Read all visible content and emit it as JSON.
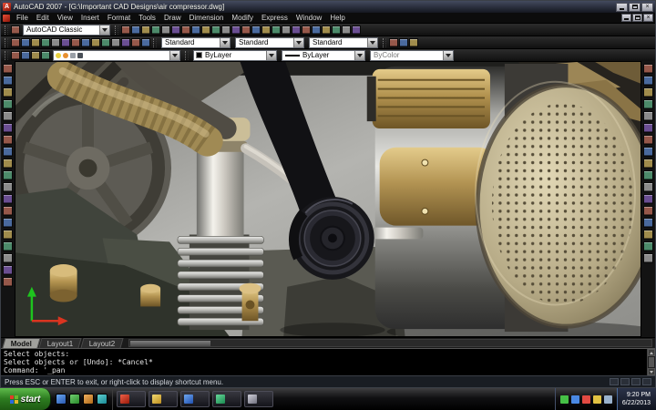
{
  "titlebar": {
    "title": "AutoCAD 2007 - [G:\\Important CAD Designs\\air compressor.dwg]"
  },
  "menubar": {
    "items": [
      "File",
      "Edit",
      "View",
      "Insert",
      "Format",
      "Tools",
      "Draw",
      "Dimension",
      "Modify",
      "Express",
      "Window",
      "Help"
    ]
  },
  "toolbars": {
    "row1_left_icons": [
      "workspaces-icon"
    ],
    "workspace_dropdown": "AutoCAD Classic",
    "row1_right_icons": [
      "qnew-icon",
      "open-icon",
      "save-icon",
      "plot-icon",
      "plot-preview-icon",
      "publish-icon",
      "cut-icon",
      "copy-clip-icon",
      "paste-icon",
      "match-properties-icon",
      "block-editor-icon",
      "undo-icon",
      "redo-icon",
      "pan-realtime-icon",
      "zoom-realtime-icon",
      "zoom-window-icon",
      "zoom-previous-icon",
      "properties-icon",
      "designcenter-icon",
      "tool-palettes-icon",
      "sheet-set-manager-icon",
      "markup-set-manager-icon",
      "quickcalc-icon",
      "help-icon"
    ],
    "row2_left_icons": [
      "dimension-linear-icon",
      "dimension-aligned-icon",
      "dimension-radius-icon",
      "dimension-diameter-icon",
      "dimension-angular-icon",
      "quick-dimension-icon",
      "baseline-dimension-icon",
      "continue-dimension-icon",
      "quick-leader-icon",
      "tolerance-icon",
      "center-mark-icon",
      "dimension-edit-icon",
      "dimension-text-edit-icon",
      "dimension-update-icon"
    ],
    "style_dropdowns": [
      "Standard",
      "Standard",
      "Standard"
    ],
    "row2_right_icons": [
      "text-style-icon",
      "render-icon",
      "orbit-icon"
    ],
    "row3_icons": [
      "layer-properties-manager-icon",
      "layer-states-manager-icon",
      "make-object-layer-current-icon",
      "layer-previous-icon"
    ],
    "layer_value": "",
    "color_value": "ByLayer",
    "linetype_value": "ByLayer",
    "plotstyle_value": "ByColor"
  },
  "left_toolbar": {
    "icons": [
      "line-icon",
      "construction-line-icon",
      "polyline-icon",
      "polygon-icon",
      "rectangle-icon",
      "arc-icon",
      "circle-icon",
      "revision-cloud-icon",
      "spline-icon",
      "ellipse-icon",
      "ellipse-arc-icon",
      "insert-block-icon",
      "make-block-icon",
      "point-icon",
      "hatch-icon",
      "gradient-icon",
      "region-icon",
      "table-icon",
      "multiline-text-icon"
    ]
  },
  "right_toolbar": {
    "icons": [
      "erase-icon",
      "copy-icon",
      "mirror-icon",
      "offset-icon",
      "array-icon",
      "move-icon",
      "rotate-icon",
      "scale-icon",
      "stretch-icon",
      "trim-icon",
      "extend-icon",
      "break-at-point-icon",
      "break-icon",
      "join-icon",
      "chamfer-icon",
      "fillet-icon",
      "explode-icon"
    ]
  },
  "tabs": {
    "items": [
      {
        "label": "Model"
      },
      {
        "label": "Layout1"
      },
      {
        "label": "Layout2"
      }
    ],
    "active": "Model"
  },
  "command": {
    "lines": [
      "Select objects:",
      "Select objects or [Undo]: *Cancel*",
      "Command: '_pan"
    ]
  },
  "statusbar": {
    "hint": "Press ESC or ENTER to exit, or right-click to display shortcut menu."
  },
  "taskbar": {
    "start_label": "start",
    "quick_launch": [
      "quick-launch-browser-icon",
      "quick-launch-desktop-icon",
      "quick-launch-explorer-icon",
      "quick-launch-media-icon"
    ],
    "apps": [
      "taskbar-autocad-button",
      "taskbar-folder-button",
      "taskbar-document-button",
      "taskbar-messenger-button",
      "taskbar-explorer-button"
    ],
    "tray_icons": [
      "tray-antivirus-icon",
      "tray-network-icon",
      "tray-updates-icon",
      "tray-volume-icon",
      "tray-battery-icon"
    ],
    "clock_time": "9:20 PM",
    "clock_date": "6/22/2013"
  },
  "model_colors": {
    "viewport_background": "#9a9a98",
    "brass": "#b2924f",
    "steel": "#c9c5bd",
    "pulley_black": "#17171b"
  }
}
